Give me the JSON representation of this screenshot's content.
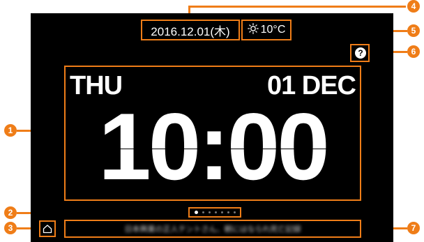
{
  "header": {
    "date": "2016.12.01(木)",
    "temperature": "10°C"
  },
  "clock": {
    "day": "THU",
    "date": "01 DEC",
    "time": "10:00"
  },
  "help": {
    "label": "?"
  },
  "ticker": {
    "text": "日本興業の正人テントさん、朝にはなられ死亡記録"
  },
  "pagination": {
    "count": 7,
    "active_index": 0
  },
  "callouts": [
    "1",
    "2",
    "3",
    "4",
    "5",
    "6",
    "7"
  ],
  "colors": {
    "accent": "#ef7d18",
    "screen": "#000000"
  }
}
